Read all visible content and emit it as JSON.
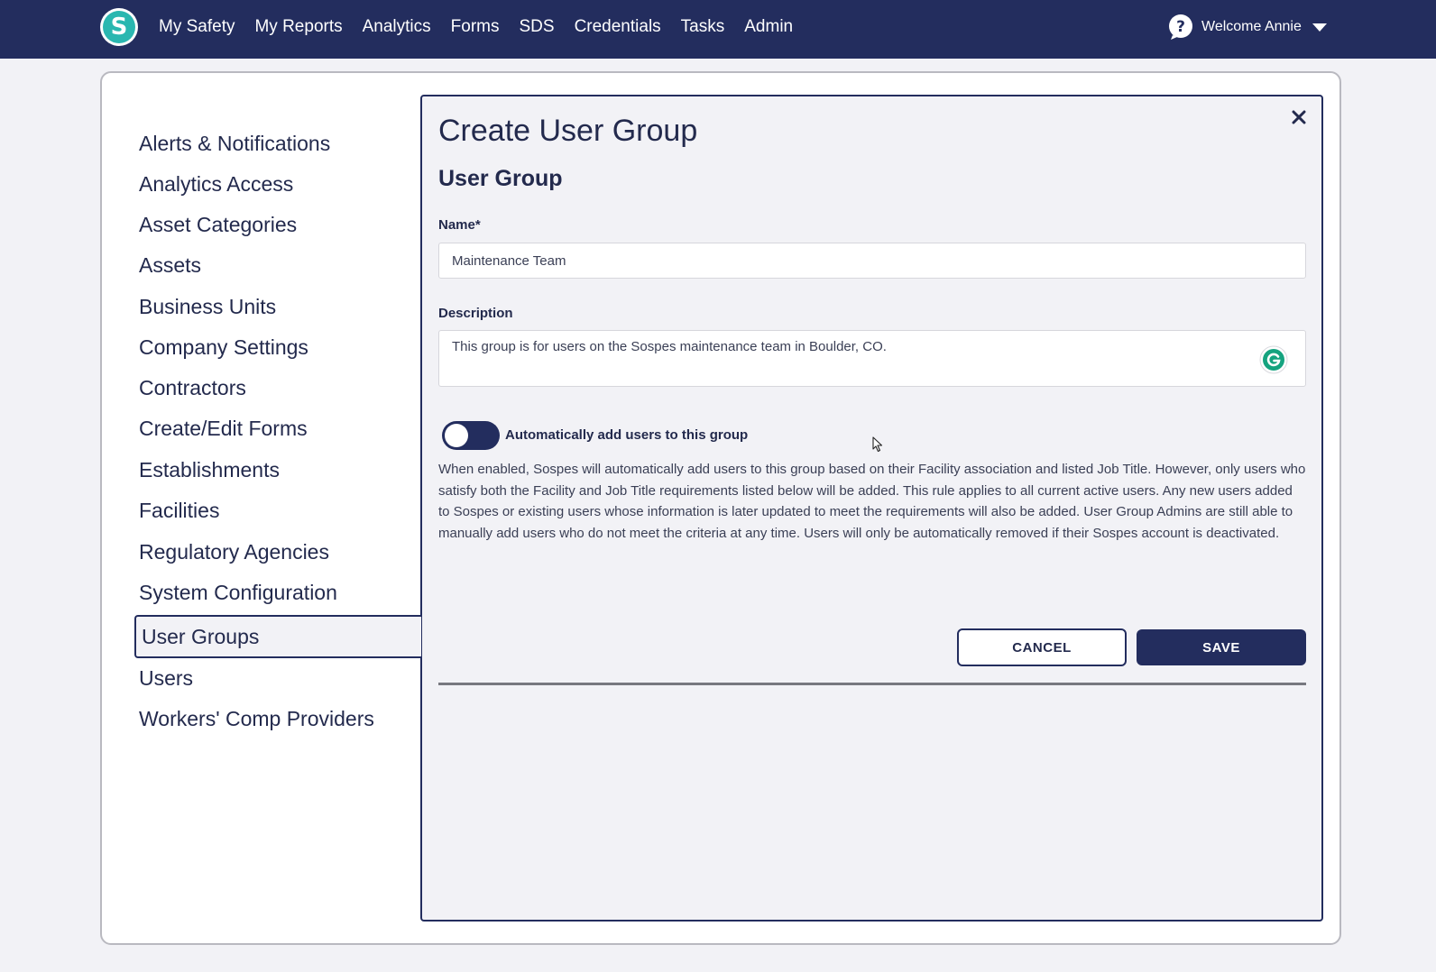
{
  "topbar": {
    "nav": [
      "My Safety",
      "My Reports",
      "Analytics",
      "Forms",
      "SDS",
      "Credentials",
      "Tasks",
      "Admin"
    ],
    "welcome": "Welcome Annie",
    "logo_letter": "S"
  },
  "sidebar": {
    "items": [
      "Alerts & Notifications",
      "Analytics Access",
      "Asset Categories",
      "Assets",
      "Business Units",
      "Company Settings",
      "Contractors",
      "Create/Edit Forms",
      "Establishments",
      "Facilities",
      "Regulatory Agencies",
      "System Configuration",
      "User Groups",
      "Users",
      "Workers' Comp Providers"
    ],
    "active": "User Groups"
  },
  "modal": {
    "title": "Create User Group",
    "section_title": "User Group",
    "name_label": "Name*",
    "name_value": "Maintenance Team",
    "description_label": "Description",
    "description_value": "This group is for users on the Sospes maintenance team in Boulder, CO.",
    "toggle_label": "Automatically add users to this group",
    "toggle_on": false,
    "help_text": "When enabled, Sospes will automatically add users to this group based on their Facility association and listed Job Title. However, only users who satisfy both the Facility and Job Title requirements listed below will be added. This rule applies to all current active users. Any new users added to Sospes or existing users whose information is later updated to meet the requirements will also be added. User Group Admins are still able to manually add users who do not meet the criteria at any time. Users will only be automatically removed if their Sospes account is deactivated.",
    "cancel_label": "CANCEL",
    "save_label": "SAVE"
  },
  "colors": {
    "brand_navy": "#232d5e",
    "logo_teal": "#2ab7b0",
    "grammarly_green": "#15a37f"
  }
}
